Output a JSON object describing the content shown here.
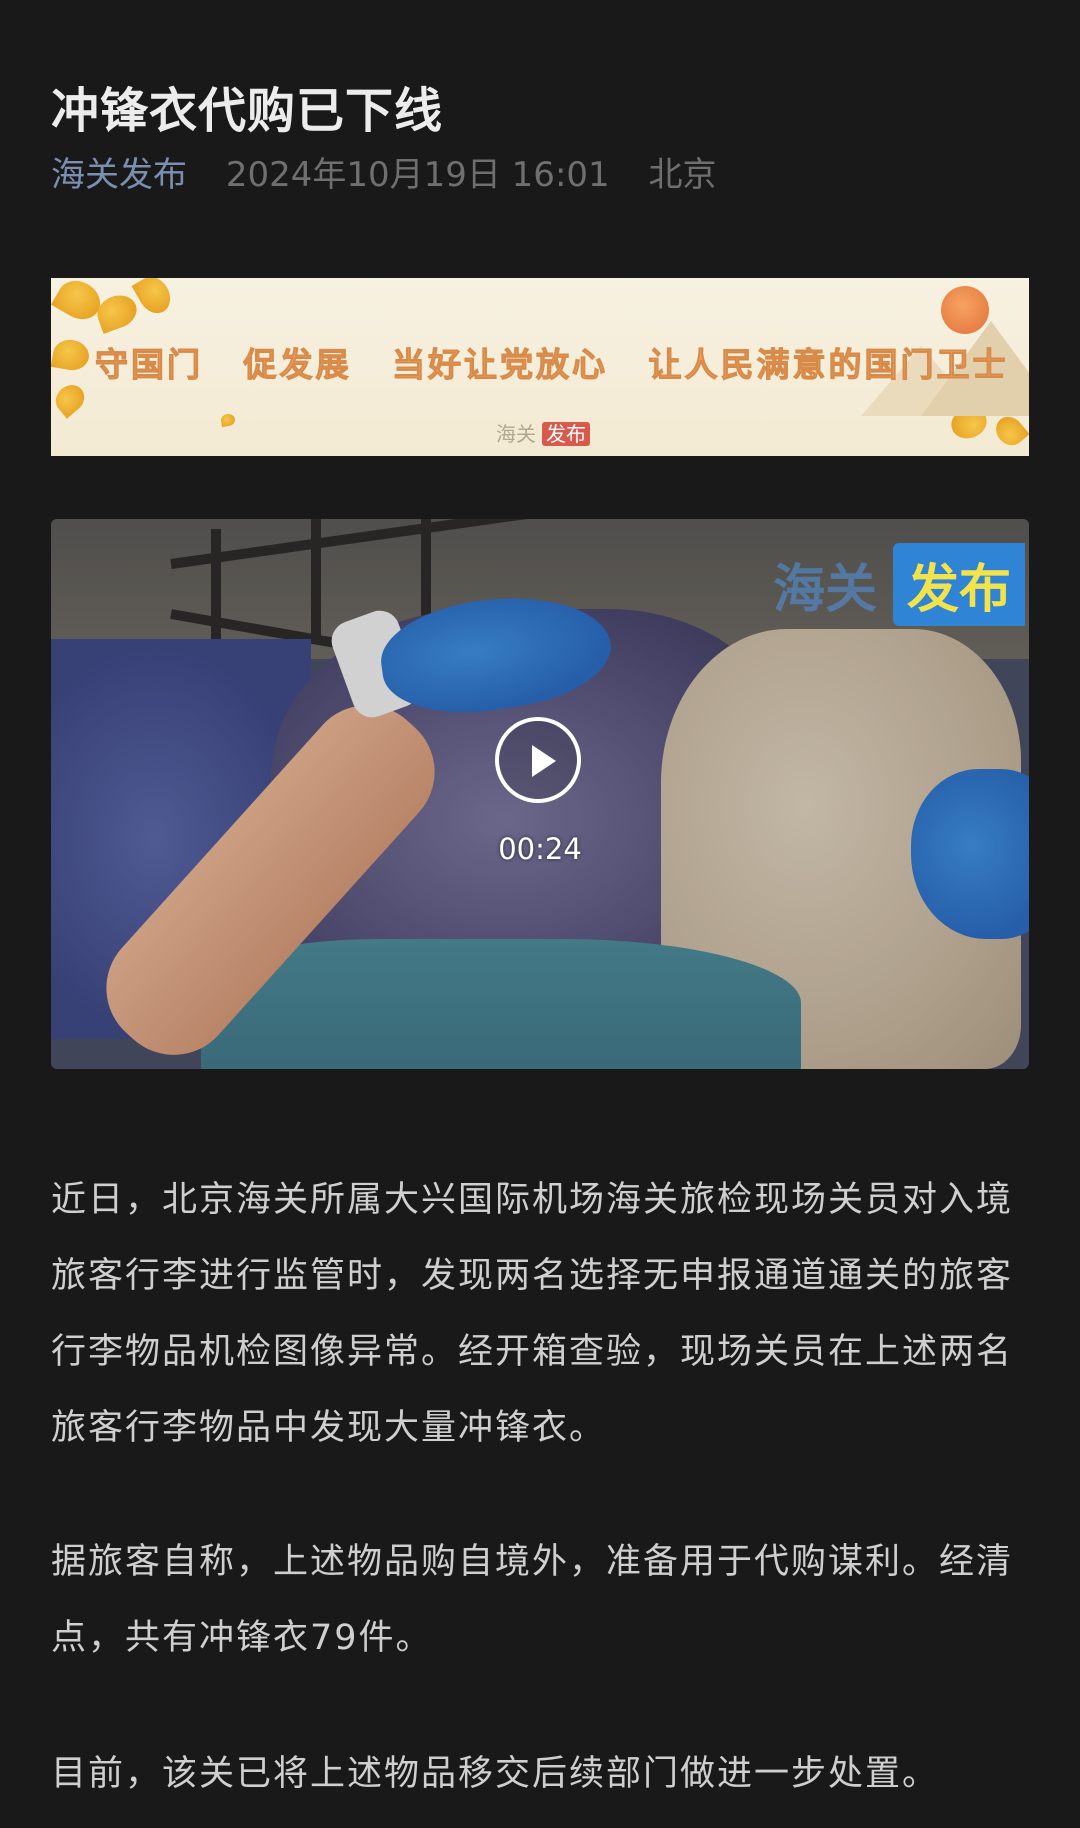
{
  "article": {
    "title": "冲锋衣代购已下线",
    "account": "海关发布",
    "date": "2024年10月19日 16:01",
    "location": "北京"
  },
  "banner": {
    "slogans": [
      "守国门",
      "促发展",
      "当好让党放心",
      "让人民满意的国门卫士"
    ],
    "logo_left": "海关",
    "logo_right": "发布",
    "colors": {
      "background": "#f4ecd6",
      "slogan": "#e8a56a",
      "leaves": "#f1b93a"
    }
  },
  "video": {
    "duration": "00:24",
    "watermark_left": "海关",
    "watermark_right": "发布",
    "play_icon": "play-icon"
  },
  "paragraphs": [
    "近日，北京海关所属大兴国际机场海关旅检现场关员对入境旅客行李进行监管时，发现两名选择无申报通道通关的旅客行李物品机检图像异常。经开箱查验，现场关员在上述两名旅客行李物品中发现大量冲锋衣。",
    "据旅客自称，上述物品购自境外，准备用于代购谋利。经清点，共有冲锋衣79件。",
    "目前，该关已将上述物品移交后续部门做进一步处置。"
  ],
  "colors": {
    "page_background": "#191919",
    "title": "#ececec",
    "account_link": "#7b8fb0",
    "meta": "#6f6f6f",
    "body_text": "#cfcfcf"
  }
}
